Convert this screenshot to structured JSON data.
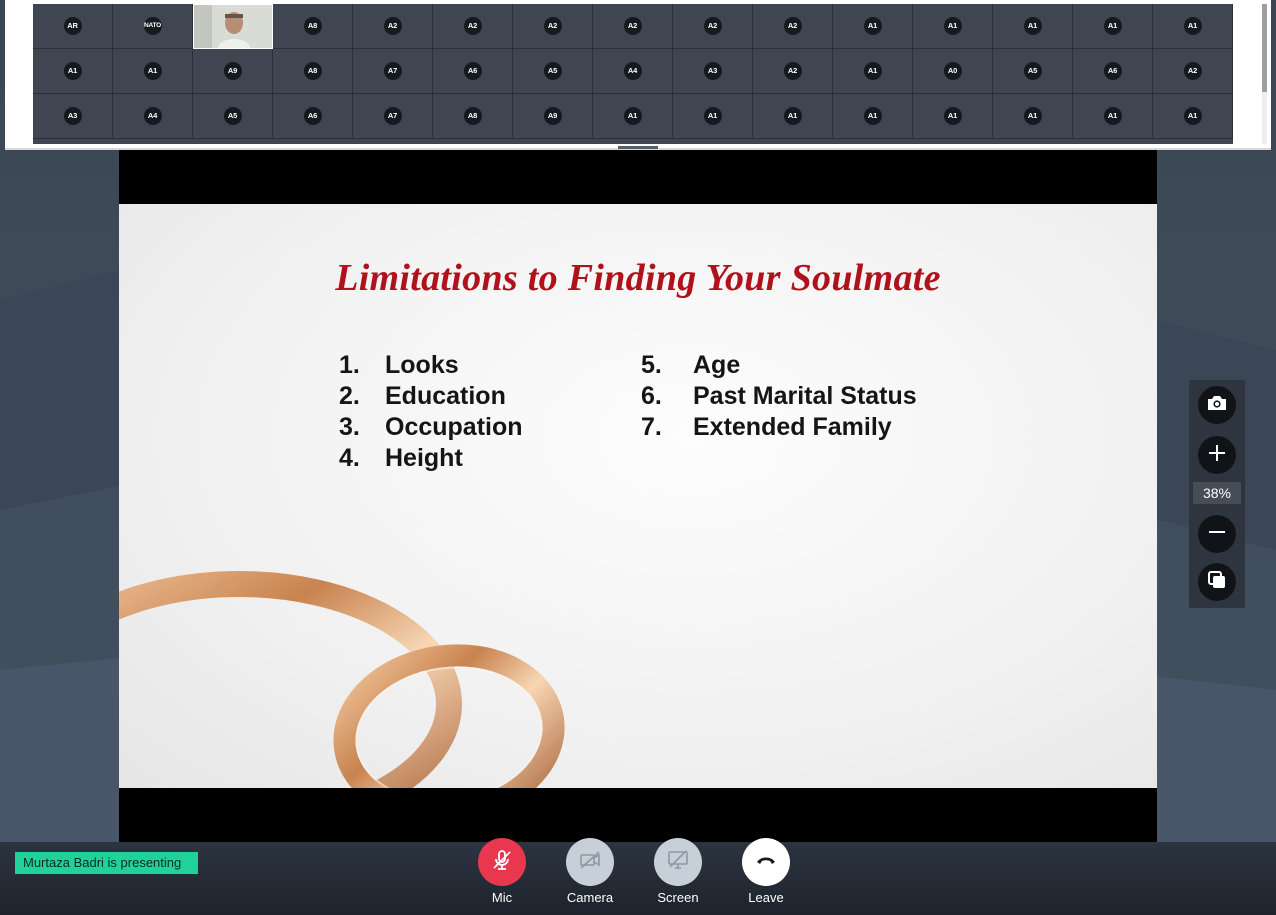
{
  "participants": {
    "rows": [
      [
        "AR",
        "NATO",
        "[video]",
        "A8",
        "A2",
        "A2",
        "A2",
        "A2",
        "A2",
        "A2",
        "A1",
        "A1",
        "A1",
        "A1",
        "A1"
      ],
      [
        "A1",
        "A1",
        "A9",
        "A8",
        "A7",
        "A6",
        "A5",
        "A4",
        "A3",
        "A2",
        "A1",
        "A0",
        "A5",
        "A6",
        "A2"
      ],
      [
        "A3",
        "A4",
        "A5",
        "A6",
        "A7",
        "A8",
        "A9",
        "A1",
        "A1",
        "A1",
        "A1",
        "A1",
        "A1",
        "A1",
        "A1"
      ]
    ]
  },
  "slide": {
    "title": "Limitations to Finding Your Soulmate",
    "left_items": [
      {
        "num": "1.",
        "text": "Looks"
      },
      {
        "num": "2.",
        "text": "Education"
      },
      {
        "num": "3.",
        "text": "Occupation"
      },
      {
        "num": "4.",
        "text": "Height"
      }
    ],
    "right_items": [
      {
        "num": "5.",
        "text": "Age"
      },
      {
        "num": "6.",
        "text": "Past Marital Status"
      },
      {
        "num": "7.",
        "text": "Extended Family"
      }
    ]
  },
  "zoom": {
    "level": "38%"
  },
  "status": {
    "presenting": "Murtaza Badri is presenting"
  },
  "controls": {
    "mic": "Mic",
    "camera": "Camera",
    "screen": "Screen",
    "leave": "Leave"
  },
  "colors": {
    "mic_active": "#e8374f",
    "control_off": "#c7cfd8",
    "leave_bg": "#ffffff",
    "presenting_badge": "#1fd29a",
    "title_red": "#b0121b"
  },
  "icons": {
    "mic": "mic-off-icon",
    "camera": "camera-off-icon",
    "screen": "screen-share-off-icon",
    "leave": "phone-hangup-icon",
    "snapshot": "camera-snapshot-icon",
    "zoom_in": "plus-icon",
    "zoom_out": "minus-icon",
    "copy": "copy-icon"
  }
}
